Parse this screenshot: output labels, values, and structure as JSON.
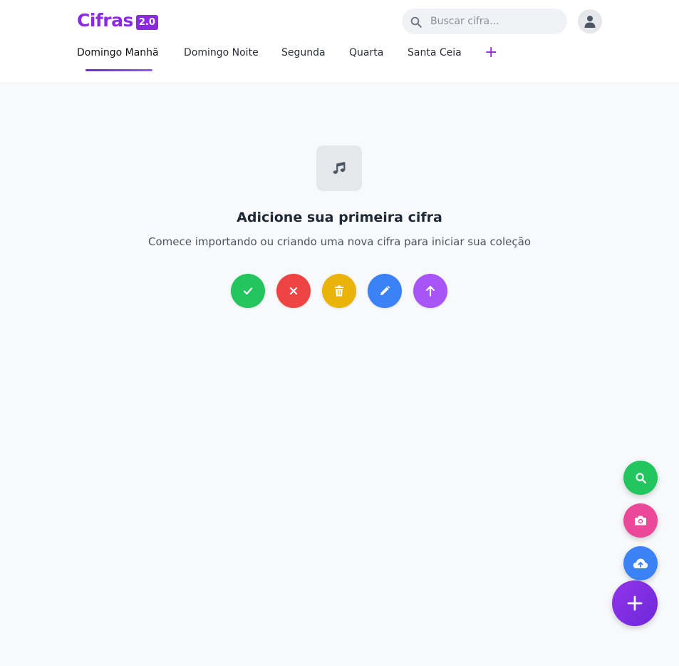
{
  "header": {
    "logo_text": "Cifras",
    "logo_badge": "2.0",
    "search_placeholder": "Buscar cifra..."
  },
  "tabs": [
    {
      "label": "Domingo Manhã",
      "active": true
    },
    {
      "label": "Domingo Noite",
      "active": false
    },
    {
      "label": "Segunda",
      "active": false
    },
    {
      "label": "Quarta",
      "active": false
    },
    {
      "label": "Santa Ceia",
      "active": false
    }
  ],
  "add_tab_label": "+",
  "empty_state": {
    "icon": "music-note-icon",
    "title": "Adicione sua primeira cifra",
    "subtitle": "Comece importando ou criando uma nova cifra para iniciar sua coleção"
  },
  "action_buttons": [
    {
      "name": "confirm-button",
      "icon": "check-icon",
      "color": "#22c55e"
    },
    {
      "name": "cancel-button",
      "icon": "close-icon",
      "color": "#ef4444"
    },
    {
      "name": "delete-button",
      "icon": "trash-icon",
      "color": "#eab308"
    },
    {
      "name": "edit-button",
      "icon": "pencil-icon",
      "color": "#3b82f6"
    },
    {
      "name": "upload-button",
      "icon": "arrow-up-icon",
      "color": "#a855f7"
    }
  ],
  "fab_buttons": [
    {
      "name": "fab-search-button",
      "icon": "search-icon",
      "color": "#22c55e"
    },
    {
      "name": "fab-camera-button",
      "icon": "camera-icon",
      "color": "#ec4899"
    },
    {
      "name": "fab-cloud-upload-button",
      "icon": "cloud-upload-icon",
      "color": "#3b82f6"
    },
    {
      "name": "fab-add-button",
      "icon": "plus-icon",
      "color": "#7c3aed"
    }
  ],
  "colors": {
    "brand": "#8a2be2",
    "background": "#f8f9fb"
  }
}
